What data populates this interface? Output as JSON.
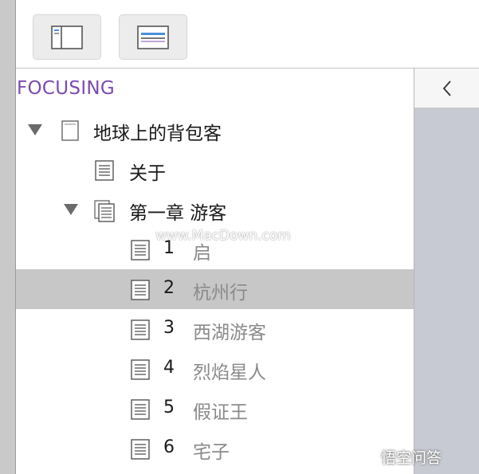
{
  "panel": {
    "title": "FOCUSING"
  },
  "tree": {
    "root": {
      "label": "地球上的背包客"
    },
    "about": {
      "label": "关于"
    },
    "chapter": {
      "label": "第一章 游客"
    },
    "sections": [
      {
        "num": "1",
        "label": "启"
      },
      {
        "num": "2",
        "label": "杭州行",
        "selected": true
      },
      {
        "num": "3",
        "label": "西湖游客"
      },
      {
        "num": "4",
        "label": "烈焰星人"
      },
      {
        "num": "5",
        "label": "假证王"
      },
      {
        "num": "6",
        "label": "宅子"
      }
    ]
  },
  "icons": {
    "toolbar": [
      "sidebar-toggle-icon",
      "outline-view-icon"
    ],
    "collapse": "chevron-left-icon",
    "page": "document-icon",
    "group": "document-stack-icon",
    "expanded": "disclosure-triangle-icon"
  },
  "watermark": "www.MacDown.com",
  "brand": "悟空问答",
  "colors": {
    "title": "#7b4bb0",
    "selection": "#c7c7c7",
    "rail": "#c7cad3"
  }
}
